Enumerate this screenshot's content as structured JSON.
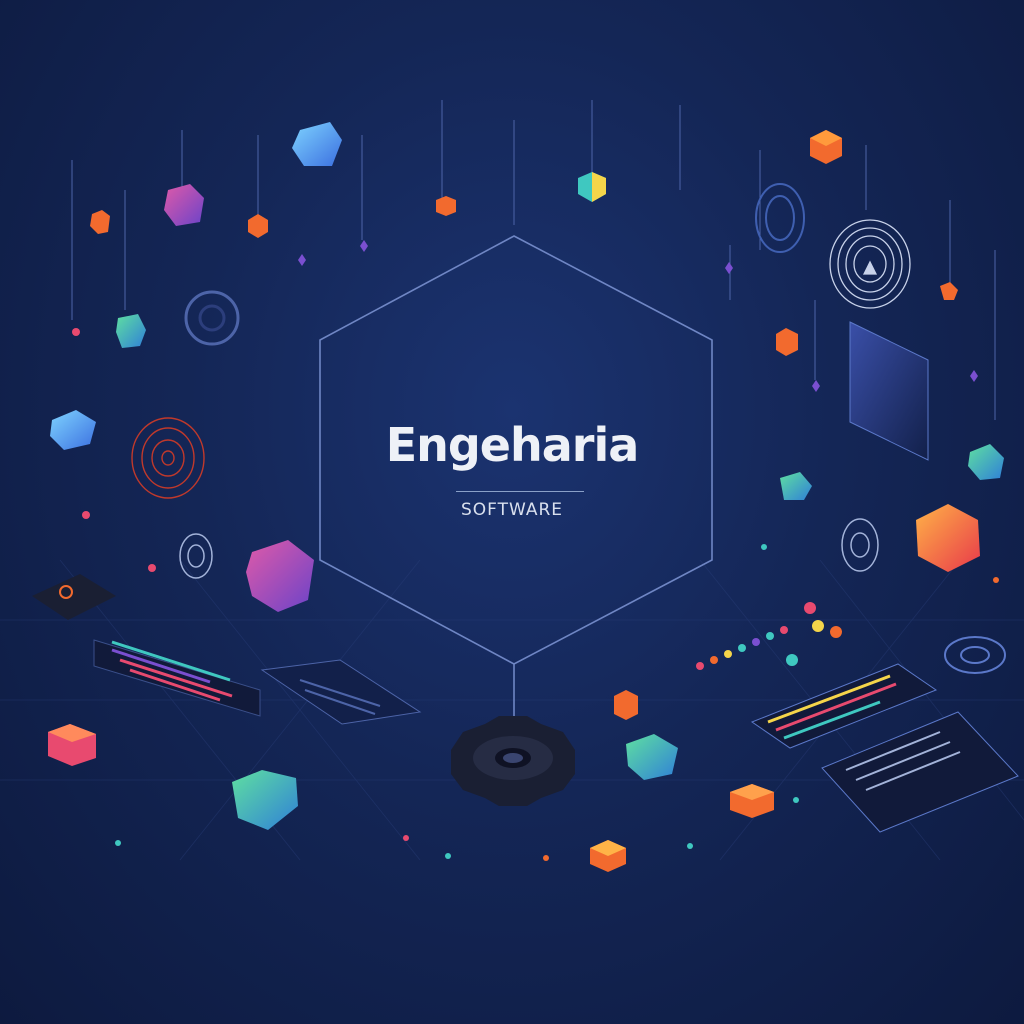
{
  "brand": {
    "name": "Engeharia",
    "tagline": "SOFTWARE"
  },
  "palette": {
    "background": "#142656",
    "frame_line": "#6f86c4",
    "text": "#eef1f7",
    "orange": "#f26a2e",
    "teal": "#3fc8c0",
    "purple": "#7a4fd0",
    "pink": "#e84a6f"
  },
  "icons": [
    "gem-icon",
    "cube-icon",
    "gear-icon",
    "concentric-circles-icon",
    "panel-icon",
    "dots-icon"
  ]
}
